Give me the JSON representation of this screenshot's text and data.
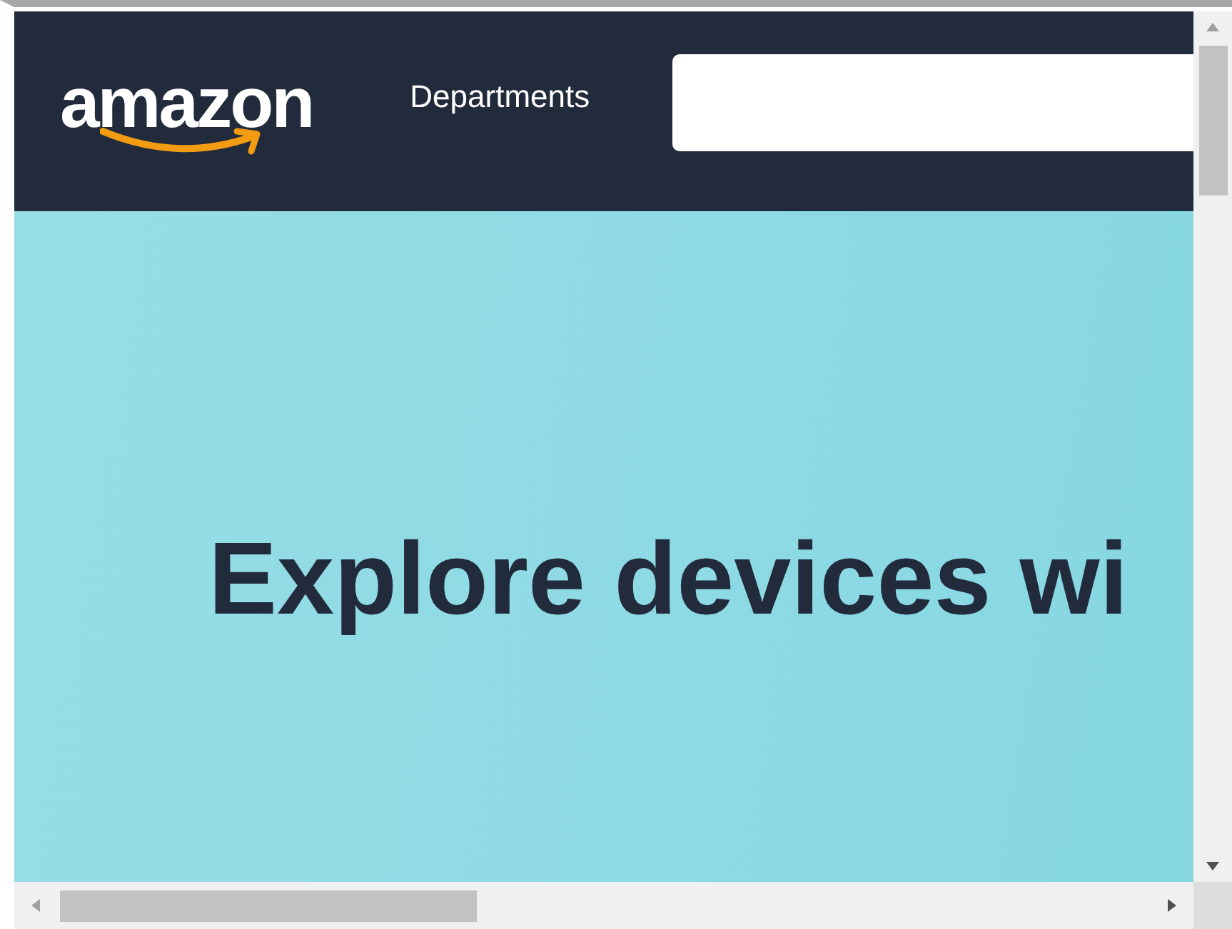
{
  "header": {
    "logo": "amazon",
    "departments": "Departments"
  },
  "hero": {
    "headline": "Explore devices wi"
  }
}
